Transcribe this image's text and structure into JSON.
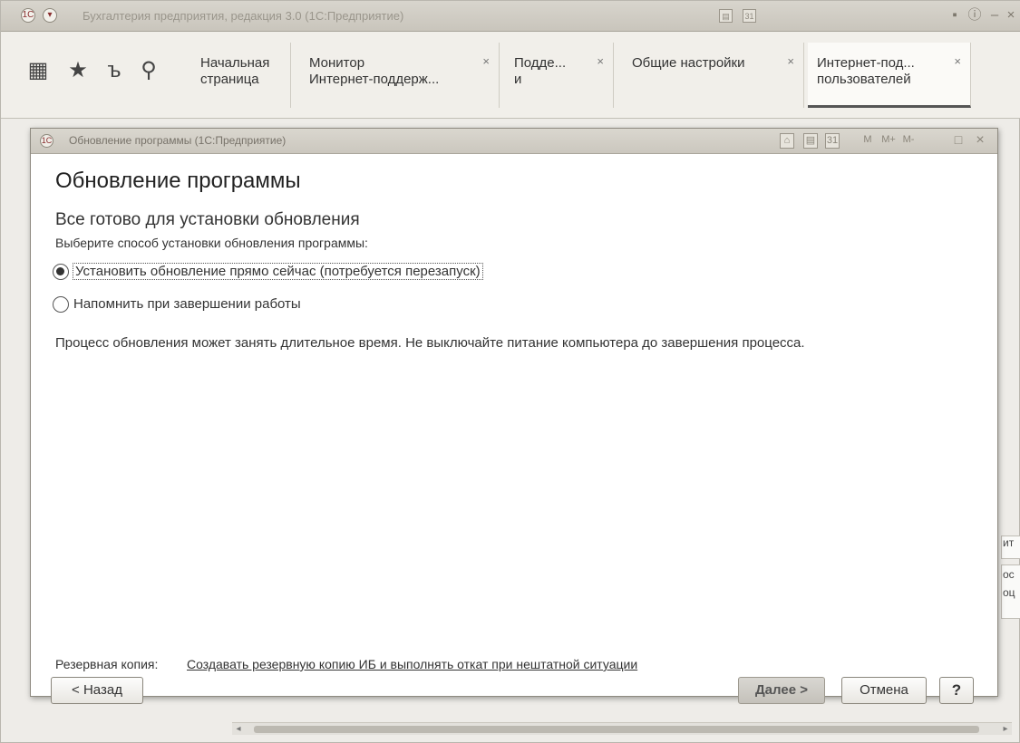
{
  "window": {
    "title": "Бухгалтерия предприятия, редакция 3.0 (1С:Предприятие)"
  },
  "toolbar": {
    "buttons": [
      {
        "name": "apps-grid-icon",
        "glyph": "▦"
      },
      {
        "name": "favorites-star-icon",
        "glyph": "★"
      },
      {
        "name": "history-icon",
        "glyph": "ъ"
      },
      {
        "name": "search-icon",
        "glyph": "⚲"
      }
    ],
    "tabs": [
      {
        "line1": "Начальная",
        "line2": "страница",
        "closable": false,
        "active": false
      },
      {
        "line1": "Монитор",
        "line2": "Интернет-поддерж...",
        "closable": true,
        "active": false
      },
      {
        "line1": "Подде...",
        "line2": "и",
        "closable": true,
        "active": false
      },
      {
        "line1": "Общие настройки",
        "line2": "",
        "closable": true,
        "active": false
      },
      {
        "line1": "Интернет-под...",
        "line2": "пользователей",
        "closable": true,
        "active": true
      }
    ],
    "close_glyph": "×"
  },
  "dialog": {
    "window_title": "Обновление программы  (1С:Предприятие)",
    "heading": "Обновление программы",
    "subheading": "Все готово для установки обновления",
    "prompt": "Выберите способ установки обновления программы:",
    "options": [
      {
        "label": "Установить обновление прямо сейчас (потребуется перезапуск)",
        "checked": true
      },
      {
        "label": "Напомнить при завершении работы",
        "checked": false
      }
    ],
    "warning": "Процесс обновления может занять длительное время. Не выключайте питание компьютера до завершения процесса.",
    "backup_label": "Резервная копия:",
    "backup_link": "Создавать резервную копию ИБ и выполнять откат при нештатной ситуации",
    "buttons": {
      "back": "< Назад",
      "next": "Далее >",
      "cancel": "Отмена",
      "help": "?"
    },
    "title_icons": [
      "M",
      "M+",
      "M-"
    ],
    "calendar_label": "31"
  },
  "background_fragments": [
    "ит",
    "ос",
    "оц"
  ],
  "colors": {
    "window_bg": "#eeece8",
    "dialog_bg": "#ffffff",
    "titlebar": "#cbc7be"
  }
}
